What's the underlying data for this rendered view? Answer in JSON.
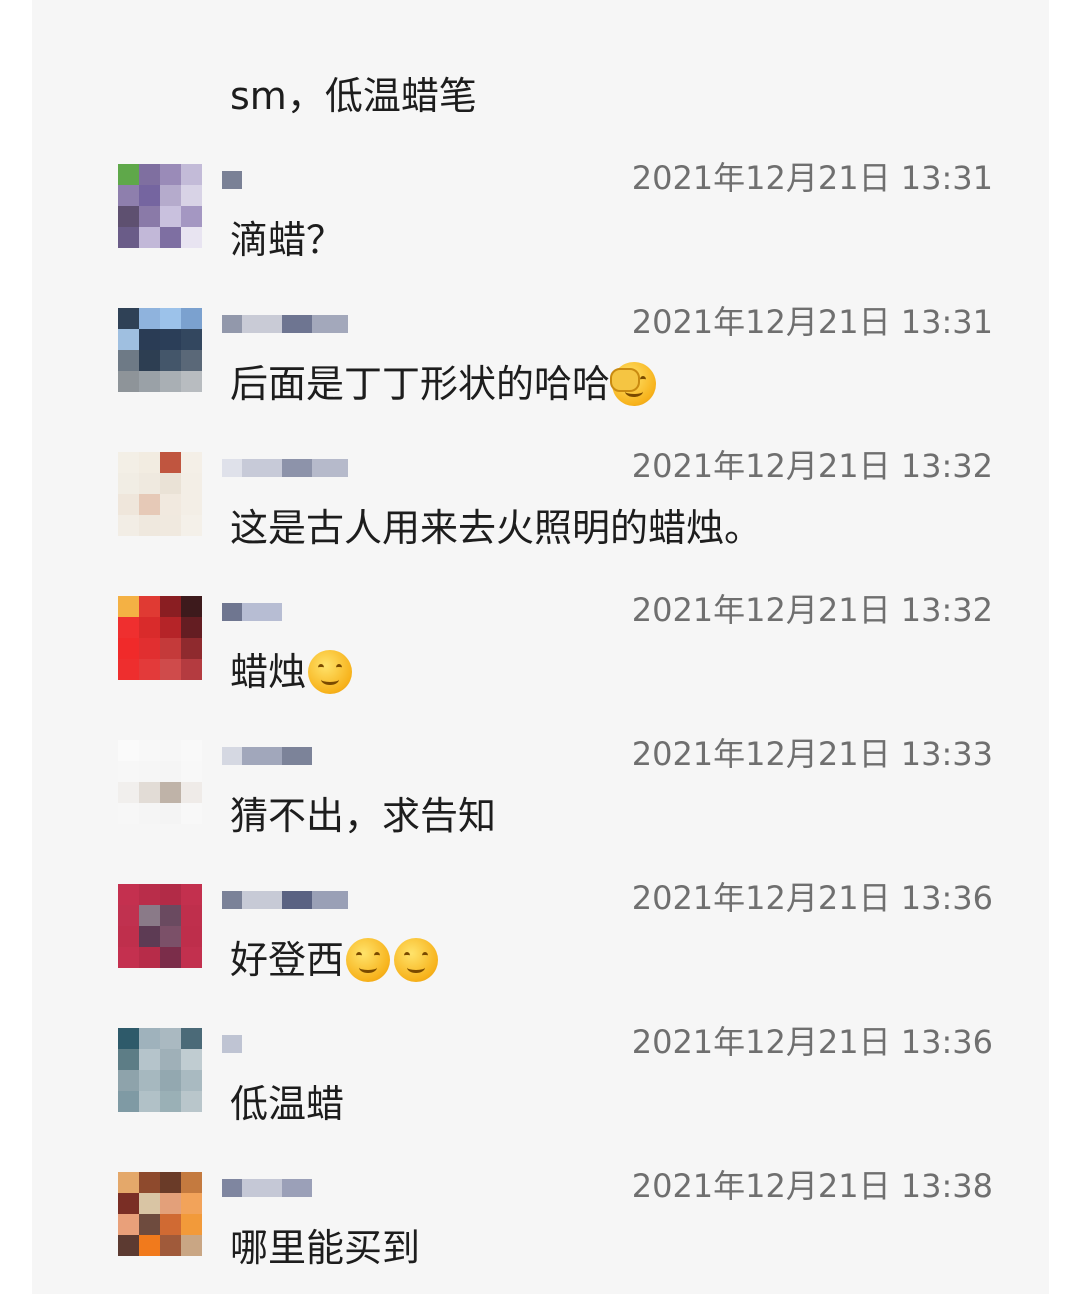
{
  "top_message": "sm，低温蜡笔",
  "comments": [
    {
      "time": "2021年12月21日 13:31",
      "text": "滴蜡？",
      "emojis": [],
      "avatar": [
        "#5fa84a",
        "#7f6fa0",
        "#9a8bb8",
        "#c3bbd8",
        "#8e7fad",
        "#7565a0",
        "#b5abcc",
        "#d8d3e6",
        "#5e5070",
        "#8a7aa8",
        "#c9c1de",
        "#a497c2",
        "#6a5c88",
        "#c2b8d8",
        "#7e6fa2",
        "#e8e4f1"
      ],
      "name": [
        "#7a8196"
      ]
    },
    {
      "time": "2021年12月21日 13:31",
      "text": "后面是丁丁形状的哈哈",
      "emojis": [
        "facepalm-emoji"
      ],
      "avatar": [
        "#2f4156",
        "#8fb3dd",
        "#9cc2ea",
        "#7ba1cf",
        "#9fbfe0",
        "#2a3c55",
        "#2b3e58",
        "#33475f",
        "#6e7a86",
        "#2d3e52",
        "#44566a",
        "#5a6878",
        "#8e9499",
        "#9aa1a7",
        "#a9afb4",
        "#b8bcc0"
      ],
      "name": [
        "#9298ab",
        "#c9cbd6",
        "#6e7591",
        "#a3a8bb"
      ]
    },
    {
      "time": "2021年12月21日 13:32",
      "text": "这是古人用来去火照明的蜡烛。",
      "emojis": [],
      "avatar": [
        "#f3efe6",
        "#f2ece1",
        "#c0553f",
        "#f4efe7",
        "#f1ede4",
        "#efe9df",
        "#eae2d6",
        "#f3eee6",
        "#efe6db",
        "#e6c9b7",
        "#f1e9df",
        "#f3eee6",
        "#f2ede5",
        "#efe8de",
        "#f0e9df",
        "#f4f0e9"
      ],
      "name": [
        "#dfe1ea",
        "#c7cad8",
        "#8d93aa",
        "#b6bacb"
      ]
    },
    {
      "time": "2021年12月21日 13:32",
      "text": "蜡烛",
      "emojis": [
        "thinking-emoji"
      ],
      "avatar": [
        "#f4b144",
        "#e03a33",
        "#8a1e22",
        "#3d1a1c",
        "#ef2f2f",
        "#d92b2b",
        "#b52428",
        "#641d22",
        "#f02a2a",
        "#e12f30",
        "#c43a3a",
        "#8f2a2e",
        "#ee2e2e",
        "#e33a3a",
        "#cf4b4b",
        "#b43b40"
      ],
      "name": [
        "#6f7690",
        "#b7bdd3"
      ]
    },
    {
      "time": "2021年12月21日 13:33",
      "text": "猜不出，求告知",
      "emojis": [],
      "avatar": [
        "#fafafa",
        "#f8f8f8",
        "#f7f7f7",
        "#f9f9f9",
        "#f7f7f7",
        "#f6f6f6",
        "#f5f5f5",
        "#f8f8f8",
        "#f1efed",
        "#e2dcd6",
        "#bfb3a8",
        "#efebe8",
        "#f7f7f7",
        "#f5f5f5",
        "#f4f4f4",
        "#f8f8f8"
      ],
      "name": [
        "#d5d8e2",
        "#a1a7bb",
        "#7c8399"
      ]
    },
    {
      "time": "2021年12月21日 13:36",
      "text": "好登西",
      "emojis": [
        "thinking-emoji",
        "thinking-emoji"
      ],
      "avatar": [
        "#c4304f",
        "#b92d4a",
        "#b22b47",
        "#c3304e",
        "#c0314f",
        "#8a7a88",
        "#6a4a60",
        "#bf2f4c",
        "#bf2f4c",
        "#5d3b54",
        "#7b5068",
        "#be2e4b",
        "#c4304f",
        "#b72c49",
        "#7b2d4a",
        "#c2304e"
      ],
      "name": [
        "#7b8298",
        "#c7cad6",
        "#5a6282",
        "#9aa0b6"
      ]
    },
    {
      "time": "2021年12月21日 13:36",
      "text": "低温蜡",
      "emojis": [],
      "avatar": [
        "#2e5a6a",
        "#9fb2bc",
        "#aab9c1",
        "#4b6a78",
        "#5d7d86",
        "#b5c4cb",
        "#9fb0b8",
        "#c0ccd1",
        "#8ea3ab",
        "#a6b8bf",
        "#93a8b0",
        "#a9bac1",
        "#7f9aa4",
        "#b1c1c7",
        "#9ab0b6",
        "#b9c6cb"
      ],
      "name": [
        "#bfc4d3"
      ]
    },
    {
      "time": "2021年12月21日 13:38",
      "text": "哪里能买到",
      "emojis": [],
      "avatar": [
        "#e4a86a",
        "#8e4a2d",
        "#6a3b28",
        "#c47a3f",
        "#7a2e25",
        "#d9c5a4",
        "#e3a07a",
        "#f2a35a",
        "#e9a07a",
        "#6e4b3e",
        "#d06a33",
        "#f29a3a",
        "#5c3a31",
        "#f17a1c",
        "#a05a3a",
        "#c9a684"
      ],
      "name": [
        "#7f86a0",
        "#c5c8d6",
        "#9ba0b8"
      ]
    }
  ]
}
